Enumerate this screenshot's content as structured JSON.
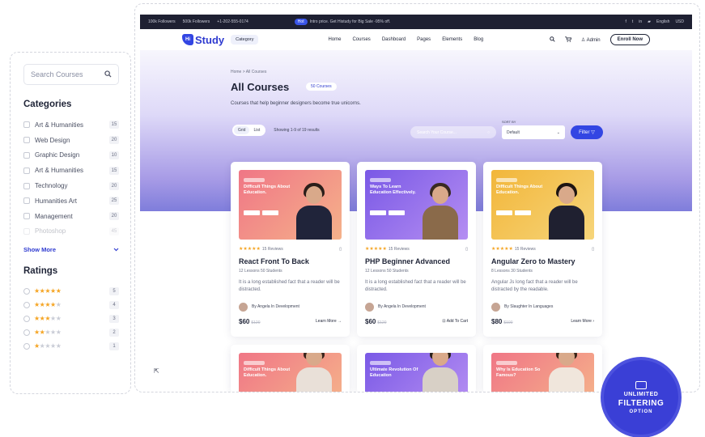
{
  "sidebar": {
    "search_placeholder": "Search Courses",
    "categories_title": "Categories",
    "categories": [
      {
        "label": "Art & Humanities",
        "count": "15"
      },
      {
        "label": "Web Design",
        "count": "20"
      },
      {
        "label": "Graphic Design",
        "count": "10"
      },
      {
        "label": "Art & Humanities",
        "count": "15"
      },
      {
        "label": "Technology",
        "count": "20"
      },
      {
        "label": "Humanities Art",
        "count": "25"
      },
      {
        "label": "Management",
        "count": "20"
      },
      {
        "label": "Photoshop",
        "count": "45"
      }
    ],
    "show_more": "Show More",
    "ratings_title": "Ratings",
    "ratings": [
      {
        "stars": 5,
        "count": "5"
      },
      {
        "stars": 4,
        "count": "4"
      },
      {
        "stars": 3,
        "count": "3"
      },
      {
        "stars": 2,
        "count": "2"
      },
      {
        "stars": 1,
        "count": "1"
      }
    ]
  },
  "topbar": {
    "followers_1": "100k Followers",
    "followers_2": "500k Followers",
    "phone": "+1-202-555-0174",
    "badge": "Hot",
    "promo": "Intro price. Get Histudy for Big Sale -95% off.",
    "language": "English",
    "currency": "USD"
  },
  "nav": {
    "logo": "Study",
    "logo_mark": "Hi",
    "category": "Category",
    "menu": [
      "Home",
      "Courses",
      "Dashboard",
      "Pages",
      "Elements",
      "Blog"
    ],
    "cart_count": "0",
    "user": "Admin",
    "enroll": "Enroll Now"
  },
  "hero": {
    "breadcrumb": "Home  >  All Courses",
    "title": "All Courses",
    "pill": "50 Courses",
    "subtitle": "Courses that help beginner designers become true unicorns.",
    "grid_label": "Grid",
    "list_label": "List",
    "result_text": "Showing 1-9 of 19 results",
    "search_placeholder": "Search Your Course...",
    "sort_label": "SORT BY",
    "sort_value": "Default",
    "filter_label": "Filter"
  },
  "courses": [
    {
      "thumb_title": "Difficult Things About Education.",
      "reviews": "15 Reviews",
      "title": "React Front To Back",
      "info": "12 Lessons   50 Students",
      "desc": "It is a long established fact that a reader will be distracted.",
      "author": "By Angela  In Development",
      "price": "$60",
      "old_price": "$120",
      "action": "Learn More"
    },
    {
      "thumb_title": "Ways To Learn Education Effectively.",
      "reviews": "15 Reviews",
      "title": "PHP Beginner Advanced",
      "info": "12 Lessons   50 Students",
      "desc": "It is a long established fact that a reader will be distracted.",
      "author": "By Angela  In Development",
      "price": "$60",
      "old_price": "$120",
      "action": "Add To Cart"
    },
    {
      "thumb_title": "Difficult Things About Education.",
      "reviews": "15 Reviews",
      "title": "Angular Zero to Mastery",
      "info": "8 Lessons   30 Students",
      "desc": "Angular Js long fact that a reader will be distracted by the readable.",
      "author": "By Slaughter  In Languages",
      "price": "$80",
      "old_price": "$100",
      "action": "Learn More"
    }
  ],
  "courses_row2": [
    {
      "thumb_title": "Difficult Things About Education."
    },
    {
      "thumb_title": "Ultimate Revolution Of Education"
    },
    {
      "thumb_title": "Why Is Education So Famous?"
    }
  ],
  "seal": {
    "line1": "UNLIMITED",
    "line2": "FILTERING",
    "line3": "OPTION"
  },
  "colors": {
    "accent": "#3346e3",
    "dark": "#1e2032",
    "star": "#f5a524"
  }
}
